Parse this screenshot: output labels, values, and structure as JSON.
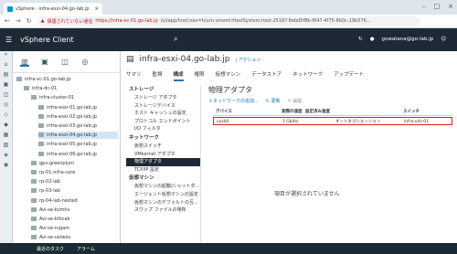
{
  "browser": {
    "tab_title": "vSphere - infra-esxi-04.go-lab.jp",
    "warning": "保護されていない通信",
    "url_host": "https://infra-vc-01.go-lab.jp",
    "url_path": "/ui/app/host;nav=h/urn:vmomi:HostSystem:host-2518?:8ebd5f8b-f647-4f75-8b0c-19b576..."
  },
  "header": {
    "app": "vSphere Client",
    "user": "gowatana@go-lab.jp"
  },
  "tree": [
    {
      "label": "infra-vc-01.go-lab.jp",
      "indent": 0
    },
    {
      "label": "infra-dc-01",
      "indent": 1
    },
    {
      "label": "infra-cluster-01",
      "indent": 2
    },
    {
      "label": "infra-esxi-01.go-lab.jp",
      "indent": 3
    },
    {
      "label": "infra-esxi-02.go-lab.jp",
      "indent": 3
    },
    {
      "label": "infra-esxi-03.go-lab.jp",
      "indent": 3
    },
    {
      "label": "infra-esxi-04.go-lab.jp",
      "indent": 3,
      "selected": true
    },
    {
      "label": "infra-esxi-05.go-lab.jp",
      "indent": 3
    },
    {
      "label": "infra-esxi-06.go-lab.jp",
      "indent": 3
    },
    {
      "label": "gpv-greenplum",
      "indent": 2
    },
    {
      "label": "rp-01-infra-core",
      "indent": 2
    },
    {
      "label": "rp-02-lab",
      "indent": 2
    },
    {
      "label": "rp-03-lab",
      "indent": 2
    },
    {
      "label": "rp-04-lab-nested",
      "indent": 2
    },
    {
      "label": "Avi-se-bzmhs",
      "indent": 2
    },
    {
      "label": "Avi-se-kthcak",
      "indent": 2
    },
    {
      "label": "Avi-se-rugam",
      "indent": 2
    },
    {
      "label": "Avi-se-uxiwzu",
      "indent": 2
    }
  ],
  "host": {
    "title": "infra-esxi-04.go-lab.jp",
    "actions": "| アクション"
  },
  "ptabs": [
    "サマリ",
    "監視",
    "構成",
    "権限",
    "仮想マシン",
    "データストア",
    "ネットワーク",
    "アップデート"
  ],
  "sections": [
    {
      "h": "ストレージ",
      "items": [
        "ストレージ アダプタ",
        "ストレージデバイス",
        "ホスト キャッシュの設定",
        "プロトコル エンドポイント",
        "I/O フィルタ"
      ]
    },
    {
      "h": "ネットワーク",
      "items": [
        "仮想スイッチ",
        "VMkernel アダプタ",
        "物理アダプタ",
        "TCP/IP 設定"
      ]
    },
    {
      "h": "仮想マシン",
      "items": [
        "仮想マシンの起動/シャットダ...",
        "エージェント仮想マシンの設定",
        "仮想マシンのデフォルトの互...",
        "スワップ ファイルの場所"
      ]
    }
  ],
  "panel": {
    "title": "物理アダプタ",
    "t1": "ネットワークの追加...",
    "t2": "更新",
    "t3": "編集",
    "cols": [
      "デバイス",
      "実際の速度",
      "設定済み速度",
      "スイッチ",
      ""
    ],
    "row": {
      "dev": "vusb0",
      "speed": "1 Gbit/s",
      "conf": "オートネゴシエーション",
      "sw": "infra-vds-01"
    },
    "empty": "項目が選択されていません"
  },
  "bottom": {
    "tasks": "最近のタスク",
    "alarms": "アラーム"
  }
}
